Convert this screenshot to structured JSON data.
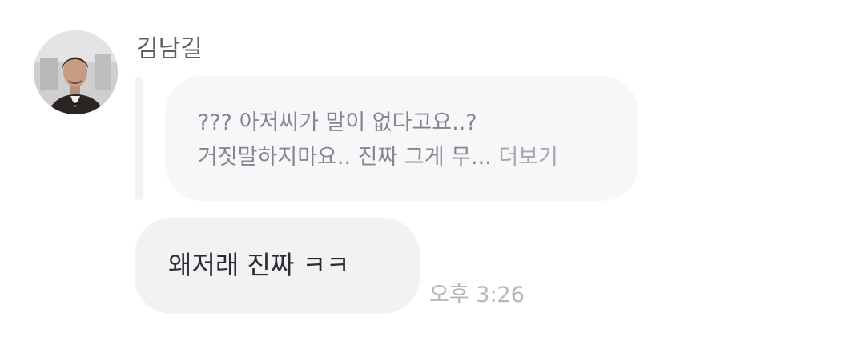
{
  "message": {
    "sender_name": "김남길",
    "quoted": {
      "line1": "??? 아저씨가 말이 없다고요..?",
      "line2": "거짓말하지마요.. 진짜 그게 무...",
      "more_label": "더보기"
    },
    "text": "왜저래 진짜 ㅋㅋ",
    "time": "오후 3:26"
  },
  "colors": {
    "quote_bubble_bg": "#f7f7f9",
    "message_bubble_bg": "#f2f2f4",
    "name_text": "#5f6064",
    "quote_text": "#86878c",
    "timestamp_text": "#b4b6ba"
  }
}
